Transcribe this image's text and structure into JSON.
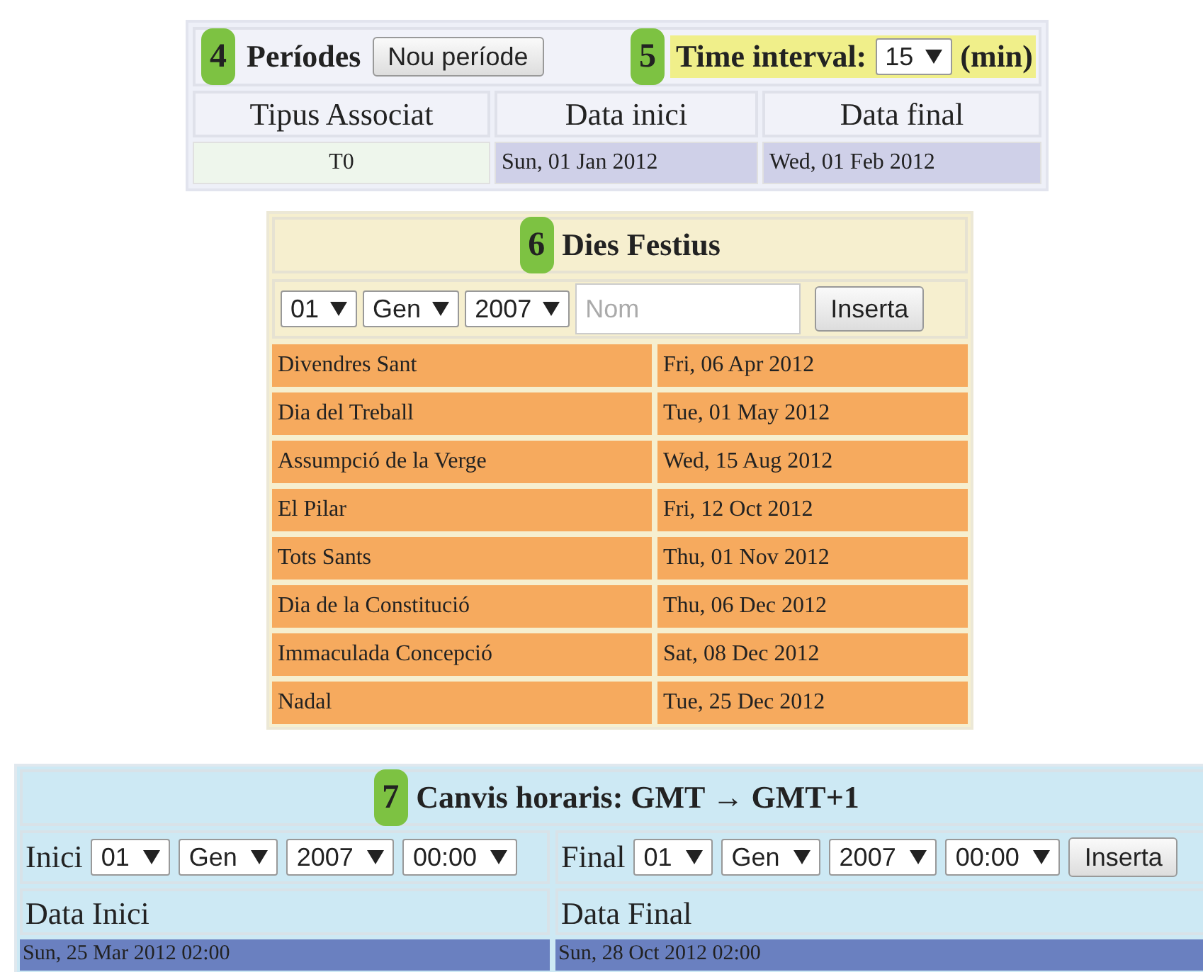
{
  "periods": {
    "badge": "4",
    "title": "Períodes",
    "new_button": "Nou període",
    "interval": {
      "badge": "5",
      "label": "Time interval:",
      "value": "15",
      "unit": "(min)"
    },
    "columns": [
      "Tipus Associat",
      "Data inici",
      "Data final"
    ],
    "rows": [
      [
        "T0",
        "Sun, 01 Jan 2012",
        "Wed, 01 Feb 2012"
      ]
    ]
  },
  "holidays": {
    "badge": "6",
    "title": "Dies Festius",
    "day": "01",
    "month": "Gen",
    "year": "2007",
    "name_placeholder": "Nom",
    "insert_button": "Inserta",
    "rows": [
      {
        "name": "Divendres Sant",
        "date": "Fri, 06 Apr 2012"
      },
      {
        "name": "Dia del Treball",
        "date": "Tue, 01 May 2012"
      },
      {
        "name": "Assumpció de la Verge",
        "date": "Wed, 15 Aug 2012"
      },
      {
        "name": "El Pilar",
        "date": "Fri, 12 Oct 2012"
      },
      {
        "name": "Tots Sants",
        "date": "Thu, 01 Nov 2012"
      },
      {
        "name": "Dia de la Constitució",
        "date": "Thu, 06 Dec 2012"
      },
      {
        "name": "Immaculada Concepció",
        "date": "Sat, 08 Dec 2012"
      },
      {
        "name": "Nadal",
        "date": "Tue, 25 Dec 2012"
      }
    ]
  },
  "time_changes": {
    "badge": "7",
    "title": "Canvis horaris: GMT → GMT+1",
    "start": {
      "label": "Inici",
      "day": "01",
      "month": "Gen",
      "year": "2007",
      "time": "00:00"
    },
    "end": {
      "label": "Final",
      "day": "01",
      "month": "Gen",
      "year": "2007",
      "time": "00:00"
    },
    "insert_button": "Inserta",
    "columns": [
      "Data Inici",
      "Data Final"
    ],
    "rows": [
      [
        "Sun, 25 Mar 2012 02:00",
        "Sun, 28 Oct 2012 02:00"
      ]
    ]
  }
}
